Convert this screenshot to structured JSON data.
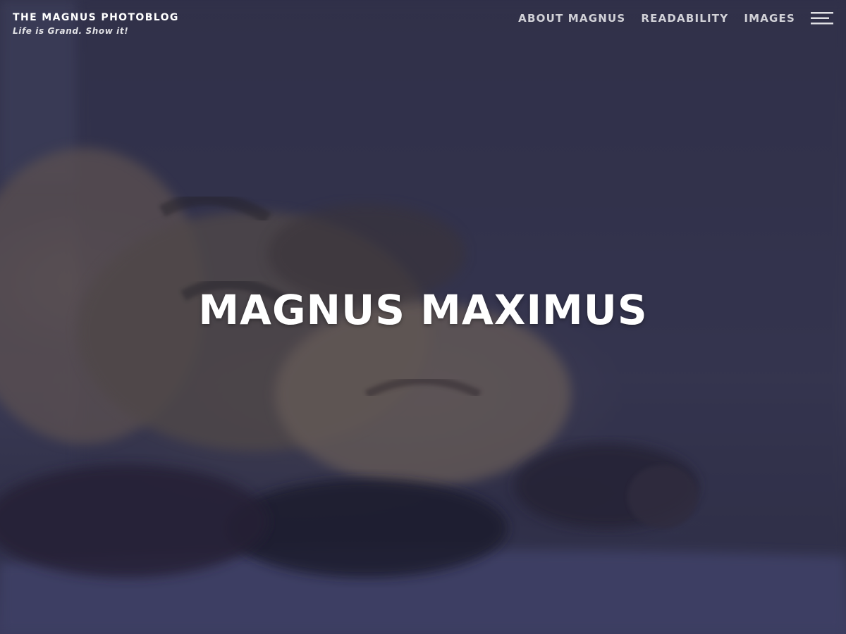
{
  "site": {
    "title": "THE MAGNUS PHOTOBLOG",
    "tagline": "Life is Grand. Show it!"
  },
  "nav": {
    "items": [
      {
        "label": "ABOUT MAGNUS"
      },
      {
        "label": "READABILITY"
      },
      {
        "label": "IMAGES"
      }
    ],
    "menu_icon": "hamburger-menu-icon"
  },
  "hero": {
    "title": "MAGNUS MAXIMUS",
    "image_subject": "tabby cat sleeping on a dark sofa",
    "overlay_color": "#1c1c3c"
  }
}
